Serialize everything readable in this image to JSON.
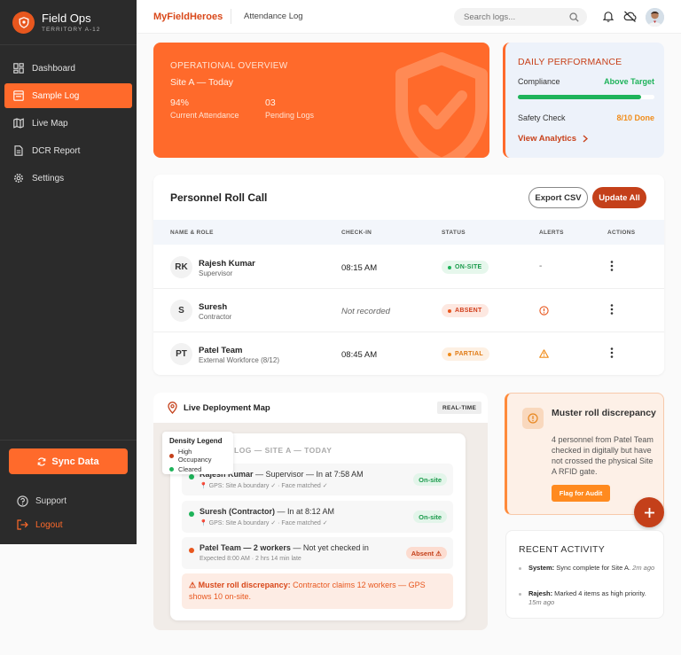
{
  "brand": {
    "title": "Field Ops",
    "subtitle": "TERRITORY A-12"
  },
  "sidebar": {
    "items": [
      {
        "label": "Dashboard",
        "icon": "dashboard-icon"
      },
      {
        "label": "Sample Log",
        "icon": "log-icon",
        "active": true
      },
      {
        "label": "Live Map",
        "icon": "map-icon"
      },
      {
        "label": "DCR Report",
        "icon": "report-icon"
      },
      {
        "label": "Settings",
        "icon": "gear-icon"
      }
    ],
    "sync_label": "Sync Data",
    "support_label": "Support",
    "logout_label": "Logout"
  },
  "header": {
    "logo": "MyFieldHeroes",
    "crumb": "Attendance Log",
    "search_placeholder": "Search logs..."
  },
  "overview": {
    "label": "OPERATIONAL OVERVIEW",
    "site": "Site A — Today",
    "attendance_value": "94%",
    "attendance_caption": "Current Attendance",
    "pending_value": "03",
    "pending_caption": "Pending Logs"
  },
  "daily": {
    "title": "DAILY PERFORMANCE",
    "compliance_label": "Compliance",
    "compliance_value": "Above Target",
    "compliance_fill": 0.9,
    "safety_label": "Safety Check",
    "safety_value": "8/10 Done",
    "link_label": "View Analytics"
  },
  "roll": {
    "title": "Personnel Roll Call",
    "export_label": "Export CSV",
    "update_label": "Update All",
    "columns": [
      "NAME & ROLE",
      "CHECK-IN",
      "STATUS",
      "ALERTS",
      "ACTIONS"
    ],
    "rows": [
      {
        "initials": "RK",
        "name": "Rajesh Kumar",
        "role": "Supervisor",
        "checkin": "08:15 AM",
        "status": "ON-SITE",
        "alert": "-"
      },
      {
        "initials": "S",
        "name": "Suresh",
        "role": "Contractor",
        "checkin": "Not recorded",
        "status": "ABSENT",
        "alert": ""
      },
      {
        "initials": "PT",
        "name": "Patel Team",
        "role": "External Workforce (8/12)",
        "checkin": "08:45 AM",
        "status": "PARTIAL",
        "alert": ""
      }
    ]
  },
  "map": {
    "title": "Live Deployment Map",
    "badge": "REAL-TIME",
    "panel_head": "LOG — SITE A — TODAY",
    "legend_title": "Density Legend",
    "legend_high": "High Occupancy",
    "legend_cleared": "Cleared",
    "entries": [
      {
        "name": "Rajesh Kumar",
        "detail": " — Supervisor — In at 7:58 AM",
        "sub": "GPS: Site A boundary ✓ · Face matched ✓",
        "chip": "On-site"
      },
      {
        "name": "Suresh (Contractor)",
        "detail": " — In at 8:12 AM",
        "sub": "GPS: Site A boundary ✓ · Face matched ✓",
        "chip": "On-site"
      },
      {
        "name": "Patel Team — 2 workers",
        "detail": " — Not yet checked in",
        "sub": "Expected 8:00 AM · 2 hrs 14 min late",
        "chip": "Absent ⚠"
      }
    ],
    "alert_bold": "⚠ Muster roll discrepancy:",
    "alert_text": " Contractor claims 12 workers — GPS shows 10 on-site."
  },
  "muster": {
    "title": "Muster roll discrepancy",
    "body": "4 personnel from Patel Team checked in digitally but have not crossed the physical Site A RFID gate.",
    "button": "Flag for Audit"
  },
  "recent": {
    "title": "RECENT ACTIVITY",
    "items": [
      {
        "who": "System:",
        "text": " Sync complete for Site A. ",
        "time": "2m ago"
      },
      {
        "who": "Rajesh:",
        "text": " Marked 4 items as high priority. ",
        "time": "15m ago"
      }
    ]
  },
  "colors": {
    "accent": "#ff6a2b",
    "dark_accent": "#c4401a",
    "sidebar": "#2b2b2b",
    "success": "#1eb35a",
    "warning": "#f08c1a"
  }
}
